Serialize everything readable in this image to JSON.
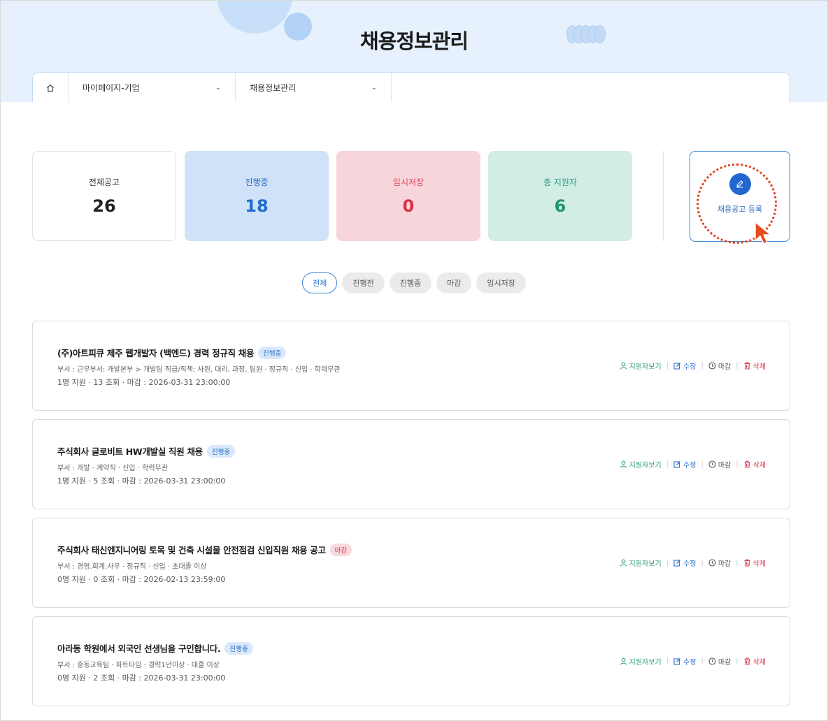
{
  "header": {
    "title": "채용정보관리",
    "breadcrumb": {
      "home_icon": "home-icon",
      "level1": "마이페이지-기업",
      "level2": "채용정보관리"
    }
  },
  "stats": {
    "total": {
      "label": "전체공고",
      "value": "26"
    },
    "active": {
      "label": "진행중",
      "value": "18"
    },
    "draft": {
      "label": "임시저장",
      "value": "0"
    },
    "applicants": {
      "label": "총 지원자",
      "value": "6"
    }
  },
  "register": {
    "label": "채용공고 등록",
    "icon": "pen-icon"
  },
  "tabs": [
    {
      "label": "전체",
      "active": true
    },
    {
      "label": "진행전",
      "active": false
    },
    {
      "label": "진행중",
      "active": false
    },
    {
      "label": "마감",
      "active": false
    },
    {
      "label": "임시저장",
      "active": false
    }
  ],
  "actions": {
    "view": "지원자보기",
    "edit": "수정",
    "close": "마감",
    "delete": "삭제"
  },
  "jobs": [
    {
      "title": "(주)아트피큐 제주 웹개발자 (백엔드) 경력 정규직 채용",
      "badge": "진행중",
      "meta": "부서 : 근무부서: 개발본부 > 개발팀 직급/직책: 사원, 대리, 과장, 팀원  ·  정규직  ·  신입  ·  학력무관",
      "stats": "1명 지원  ·  13 조회  ·  마감 : 2026-03-31 23:00:00"
    },
    {
      "title": "주식회사 글로비트 HW개발실 직원 채용",
      "badge": "진행중",
      "meta": "부서 : 개발  ·  계약직  ·  신입  ·  학력무관",
      "stats": "1명 지원  ·  5 조회  ·  마감 : 2026-03-31 23:00:00"
    },
    {
      "title": "주식회사 태신엔지니어링 토목 및 건축 시설물 안전점검 신입직원 채용 공고",
      "badge": "마감",
      "meta": "부서 : 경영.회계.사무  ·  정규직  ·  신입  ·  초대졸 이상",
      "stats": "0명 지원  ·  0 조회  ·  마감 : 2026-02-13 23:59:00"
    },
    {
      "title": "아라동 학원에서 외국인 선생님을 구인합니다.",
      "badge": "진행중",
      "meta": "부서 : 중등교육팀  ·  파트타임  ·  경력1년이상  ·  대졸 이상",
      "stats": "0명 지원  ·  2 조회  ·  마감 : 2026-03-31 23:00:00"
    }
  ],
  "colors": {
    "hero_bg": "#e6f1fd",
    "accent_blue": "#2266d0",
    "success_green": "#2f9c7d",
    "danger_red": "#d93a50",
    "highlight_ring": "#e5431d"
  }
}
